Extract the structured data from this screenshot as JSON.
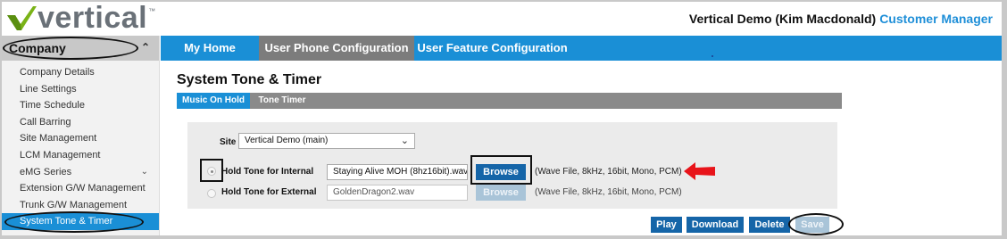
{
  "brand": {
    "name": "vertical",
    "tm": "™",
    "accent_color": "#7ab317",
    "text_color": "#6a7178"
  },
  "header": {
    "user_text": "Vertical Demo (Kim Macdonald)",
    "role_link": "Customer Manager"
  },
  "sidebar": {
    "title": "Company",
    "title_icon": "chevron-up-icon",
    "items": [
      {
        "label": "Company Details"
      },
      {
        "label": "Line Settings"
      },
      {
        "label": "Time Schedule"
      },
      {
        "label": "Call Barring"
      },
      {
        "label": "Site Management"
      },
      {
        "label": "LCM Management"
      },
      {
        "label": "eMG Series",
        "icon": "chevron-down-icon"
      },
      {
        "label": "Extension G/W Management"
      },
      {
        "label": "Trunk G/W Management"
      },
      {
        "label": "System Tone & Timer",
        "active": true
      }
    ]
  },
  "topnav": {
    "tabs": [
      {
        "label": "My Home"
      },
      {
        "label": "User Phone Configuration",
        "active": true
      },
      {
        "label": "User Feature Configuration"
      }
    ]
  },
  "main": {
    "title": "System Tone & Timer",
    "subtabs": [
      {
        "label": "Music On Hold",
        "active": true
      },
      {
        "label": "Tone Timer"
      }
    ],
    "site": {
      "label": "Site",
      "selected": "Vertical Demo (main)"
    },
    "internal": {
      "label": "Hold Tone for Internal",
      "file": "Staying Alive MOH (8hz16bit).wav",
      "browse": "Browse",
      "hint": "(Wave File, 8kHz, 16bit, Mono, PCM)"
    },
    "external": {
      "label": "Hold Tone for External",
      "file": "GoldenDragon2.wav",
      "browse": "Browse",
      "hint": "(Wave File, 8kHz, 16bit, Mono, PCM)"
    },
    "actions": {
      "play": "Play",
      "download": "Download",
      "delete": "Delete",
      "save": "Save"
    }
  },
  "colors": {
    "primary_blue": "#1a8fd6",
    "button_blue": "#1565a8",
    "arrow_red": "#e8141a"
  }
}
